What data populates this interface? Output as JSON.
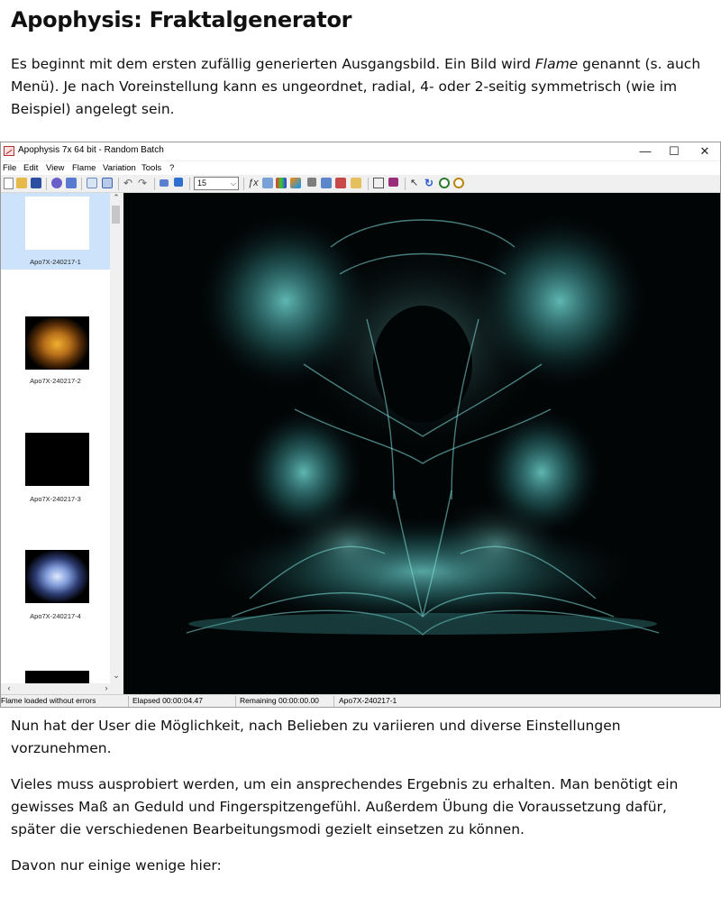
{
  "document": {
    "title": "Apophysis: Fraktalgenerator",
    "intro": {
      "before": "Es beginnt mit dem ersten zufällig generierten Ausgangsbild. Ein Bild wird ",
      "emphasis": "Flame",
      "after": " genannt (s. auch Menü). Je nach Voreinstellung kann es ungeordnet, radial, 4- oder 2-seitig symmetrisch (wie im Beispiel) angelegt sein."
    },
    "paragraphs": [
      "Nun hat der User die Möglichkeit, nach Belieben zu variieren und diverse Einstellungen vorzunehmen.",
      "Vieles muss ausprobiert werden, um ein ansprechendes Ergebnis zu erhalten. Man benötigt ein gewisses Maß an Geduld und Fingerspitzengefühl. Außerdem Übung die Voraussetzung dafür, später die verschiedenen Bearbeitungsmodi gezielt einsetzen zu können.",
      "Davon nur einige wenige hier:"
    ]
  },
  "window": {
    "title": "Apophysis 7x 64 bit - Random Batch",
    "controls": {
      "minimize": "—",
      "maximize": "☐",
      "close": "✕"
    },
    "menu": [
      "File",
      "Edit",
      "View",
      "Flame",
      "Variation",
      "Tools",
      "?"
    ],
    "toolbar": {
      "quality_value": "15"
    },
    "thumbnails": [
      {
        "label": "Apo7X-240217-1",
        "selected": true,
        "bg": "#ffffff"
      },
      {
        "label": "Apo7X-240217-2",
        "selected": false,
        "bg": "#000000"
      },
      {
        "label": "Apo7X-240217-3",
        "selected": false,
        "bg": "#000000"
      },
      {
        "label": "Apo7X-240217-4",
        "selected": false,
        "bg": "#000000"
      },
      {
        "label": "",
        "selected": false,
        "bg": "#000000"
      }
    ],
    "status": {
      "message": "Flame loaded without errors",
      "elapsed": "Elapsed 00:00:04.47",
      "remaining": "Remaining 00:00:00.00",
      "flame_name": "Apo7X-240217-1"
    }
  },
  "colors": {
    "fractal_cyan": "#5fd0d0",
    "fractal_orange": "#e8a020",
    "fractal_blue": "#9bb8ff",
    "selection": "#cce3fb"
  }
}
